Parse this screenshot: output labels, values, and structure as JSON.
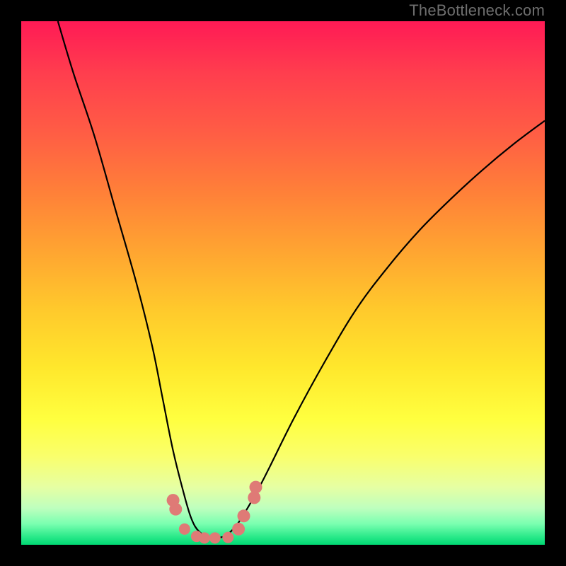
{
  "watermark": "TheBottleneck.com",
  "chart_data": {
    "type": "line",
    "title": "",
    "xlabel": "",
    "ylabel": "",
    "xlim": [
      0,
      100
    ],
    "ylim": [
      0,
      100
    ],
    "series": [
      {
        "name": "curve",
        "x": [
          7,
          10,
          14,
          18,
          22,
          25,
          27,
          29,
          31,
          32.5,
          34,
          36,
          38.5,
          40,
          42,
          46,
          52,
          58,
          64,
          70,
          76,
          82,
          88,
          94,
          100
        ],
        "values": [
          100,
          90,
          78,
          64,
          50,
          38,
          28,
          18,
          10,
          5,
          2.5,
          1.5,
          1.5,
          2.5,
          5,
          12,
          24,
          35,
          45,
          53,
          60,
          66,
          71.5,
          76.5,
          81
        ]
      }
    ],
    "markers": {
      "name": "points",
      "x": [
        29,
        29.5,
        31.2,
        33.5,
        35,
        37,
        39.5,
        41.5,
        42.5,
        44.5,
        44.8
      ],
      "y": [
        8.5,
        6.8,
        3.0,
        1.6,
        1.3,
        1.3,
        1.4,
        3.0,
        5.5,
        9.0,
        11.0
      ],
      "sizes": [
        9,
        9,
        8,
        8,
        8,
        8,
        8,
        9,
        9,
        9,
        9
      ]
    },
    "gradient_bands": [
      {
        "color": "#ff1a55",
        "pos": 0
      },
      {
        "color": "#ff8138",
        "pos": 33
      },
      {
        "color": "#ffe72c",
        "pos": 66
      },
      {
        "color": "#00d873",
        "pos": 100
      }
    ]
  }
}
